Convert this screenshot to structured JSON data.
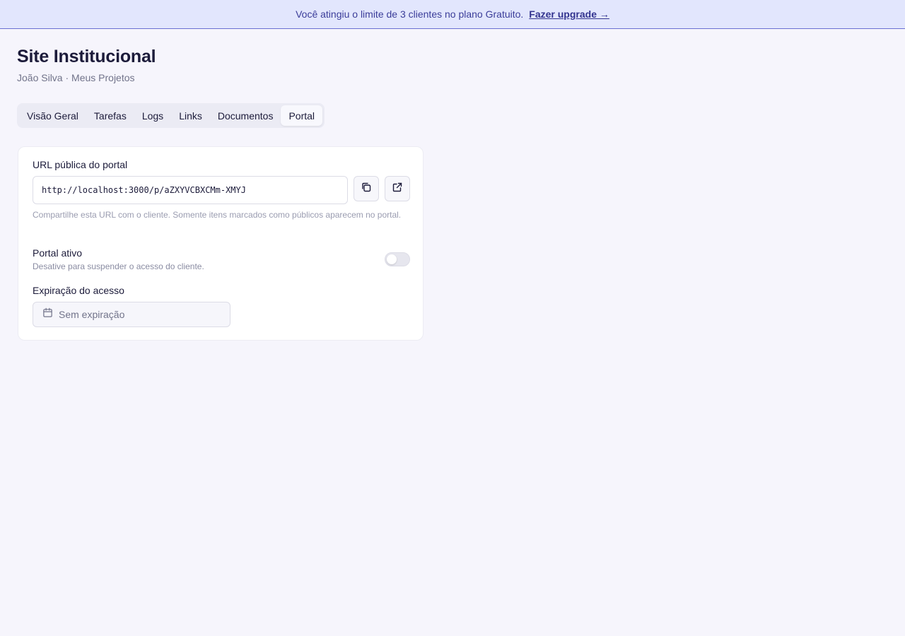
{
  "banner": {
    "message": "Você atingiu o limite de 3 clientes no plano Gratuito.",
    "link_label": "Fazer upgrade →"
  },
  "header": {
    "title": "Site Institucional",
    "breadcrumb": "João Silva · Meus Projetos"
  },
  "tabs": [
    {
      "label": "Visão Geral",
      "active": false
    },
    {
      "label": "Tarefas",
      "active": false
    },
    {
      "label": "Logs",
      "active": false
    },
    {
      "label": "Links",
      "active": false
    },
    {
      "label": "Documentos",
      "active": false
    },
    {
      "label": "Portal",
      "active": true
    }
  ],
  "portal": {
    "url_label": "URL pública do portal",
    "url_value": "http://localhost:3000/p/aZXYVCBXCMm-XMYJ",
    "copy_icon": "copy-icon",
    "open_icon": "external-link-icon",
    "help_text": "Compartilhe esta URL com o cliente. Somente itens marcados como públicos aparecem no portal.",
    "active_label": "Portal ativo",
    "active_description": "Desative para suspender o acesso do cliente.",
    "active_on": false,
    "expiration_label": "Expiração do acesso",
    "expiration_value": "Sem expiração",
    "calendar_icon": "calendar-icon"
  },
  "colors": {
    "page_bg": "#f6f5fc",
    "banner_bg": "#e2e6fd",
    "banner_text": "#3b3d99",
    "text_primary": "#1c1b3a",
    "text_muted": "#71738a"
  }
}
